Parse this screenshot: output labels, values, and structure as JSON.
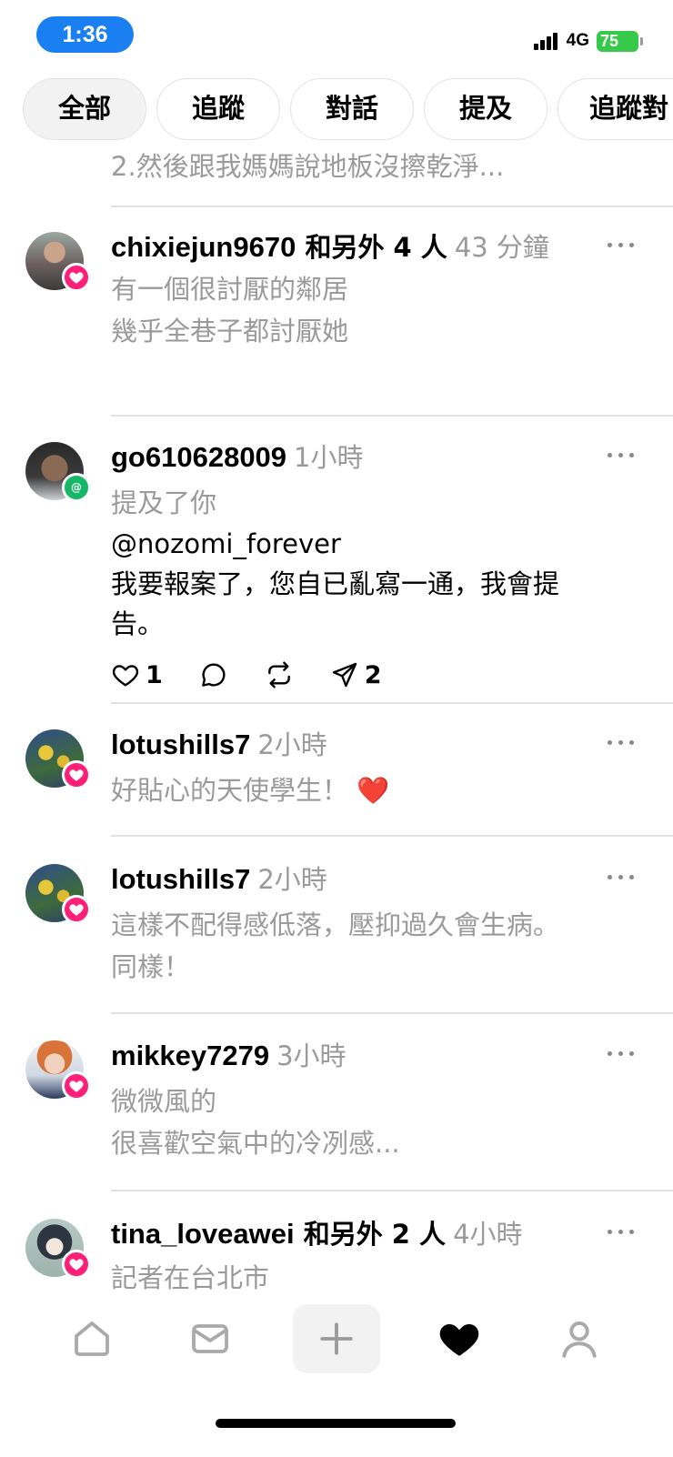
{
  "status": {
    "time": "1:36",
    "network": "4G",
    "battery": "75"
  },
  "tabs": [
    {
      "label": "全部",
      "active": true
    },
    {
      "label": "追蹤",
      "active": false
    },
    {
      "label": "對話",
      "active": false
    },
    {
      "label": "提及",
      "active": false
    },
    {
      "label": "追蹤對",
      "active": false
    }
  ],
  "partial_previous_text": "2.然後跟我媽媽說地板沒擦乾淨...",
  "feed": [
    {
      "username": "chixiejun9670",
      "extra": " 和另外 4 人",
      "time": "43 分鐘",
      "lines": [
        "有一個很討厭的鄰居",
        "幾乎全巷子都討厭她"
      ],
      "badge": "heart-icon"
    },
    {
      "username": "go610628009",
      "time": "1小時",
      "grey_line": "提及了你",
      "mention": "@nozomi_forever",
      "content": "我要報案了，您自已亂寫一通，我會提告。",
      "badge": "threads-icon",
      "actions": {
        "likes": "1",
        "shares": "2"
      }
    },
    {
      "username": "lotushills7",
      "time": "2小時",
      "lines": [
        "好貼心的天使學生！ ❤️"
      ],
      "badge": "heart-icon"
    },
    {
      "username": "lotushills7",
      "time": "2小時",
      "lines": [
        "這樣不配得感低落，壓抑過久會生病。",
        "同樣！"
      ],
      "badge": "heart-icon"
    },
    {
      "username": "mikkey7279",
      "time": "3小時",
      "lines": [
        "微微風的",
        "很喜歡空氣中的冷冽感..."
      ],
      "badge": "heart-icon"
    },
    {
      "username": "tina_loveawei",
      "extra": " 和另外 2 人",
      "time": "4小時",
      "lines": [
        "記者在台北市"
      ],
      "badge": "heart-icon"
    }
  ],
  "nav": [
    "home-icon",
    "inbox-icon",
    "create-icon",
    "activity-heart-icon",
    "profile-icon"
  ]
}
